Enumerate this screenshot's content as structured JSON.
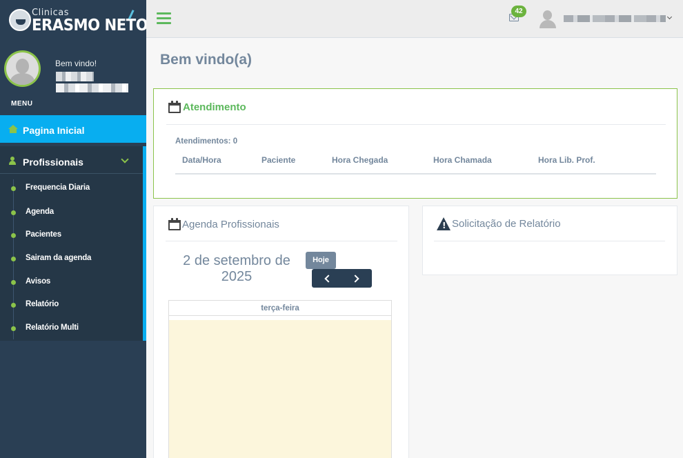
{
  "sidebar": {
    "brand_small": "Clinicas",
    "brand_large": "ERASMO NETO",
    "welcome": "Bem vindo!",
    "menu_heading": "MENU",
    "home_label": "Pagina Inicial",
    "section_label": "Profissionais",
    "sub_items": [
      {
        "label": "Frequencia Diaria"
      },
      {
        "label": "Agenda"
      },
      {
        "label": "Pacientes"
      },
      {
        "label": "Sairam da agenda"
      },
      {
        "label": "Avisos"
      },
      {
        "label": "Relatório"
      },
      {
        "label": "Relatório Multi"
      }
    ]
  },
  "topbar": {
    "notification_count": "42"
  },
  "main": {
    "page_title": "Bem vindo(a)",
    "atendimento": {
      "title": "Atendimento",
      "count_text": "Atendimentos: 0",
      "columns": [
        "Data/Hora",
        "Paciente",
        "Hora Chegada",
        "Hora Chamada",
        "Hora Lib. Prof."
      ]
    },
    "agenda": {
      "title": "Agenda Profissionais",
      "date_line1": "2 de setembro de",
      "date_line2": "2025",
      "today_button": "Hoje",
      "day_header": "terça-feira"
    },
    "solicitacao": {
      "title": "Solicitação de Relatório"
    }
  },
  "colors": {
    "sidebar_bg": "#2a3f54",
    "active_nav": "#08aef0",
    "accent_green": "#8bc34a",
    "title_green": "#5cb85c",
    "calendar_today_bg": "#fcf6dc"
  },
  "icons": {
    "home": "home-icon",
    "profissionais": "users-icon",
    "menu": "hamburger-icon",
    "notifications": "envelope-icon",
    "atendimento": "calendar-icon",
    "solicitacao": "warning-icon"
  }
}
